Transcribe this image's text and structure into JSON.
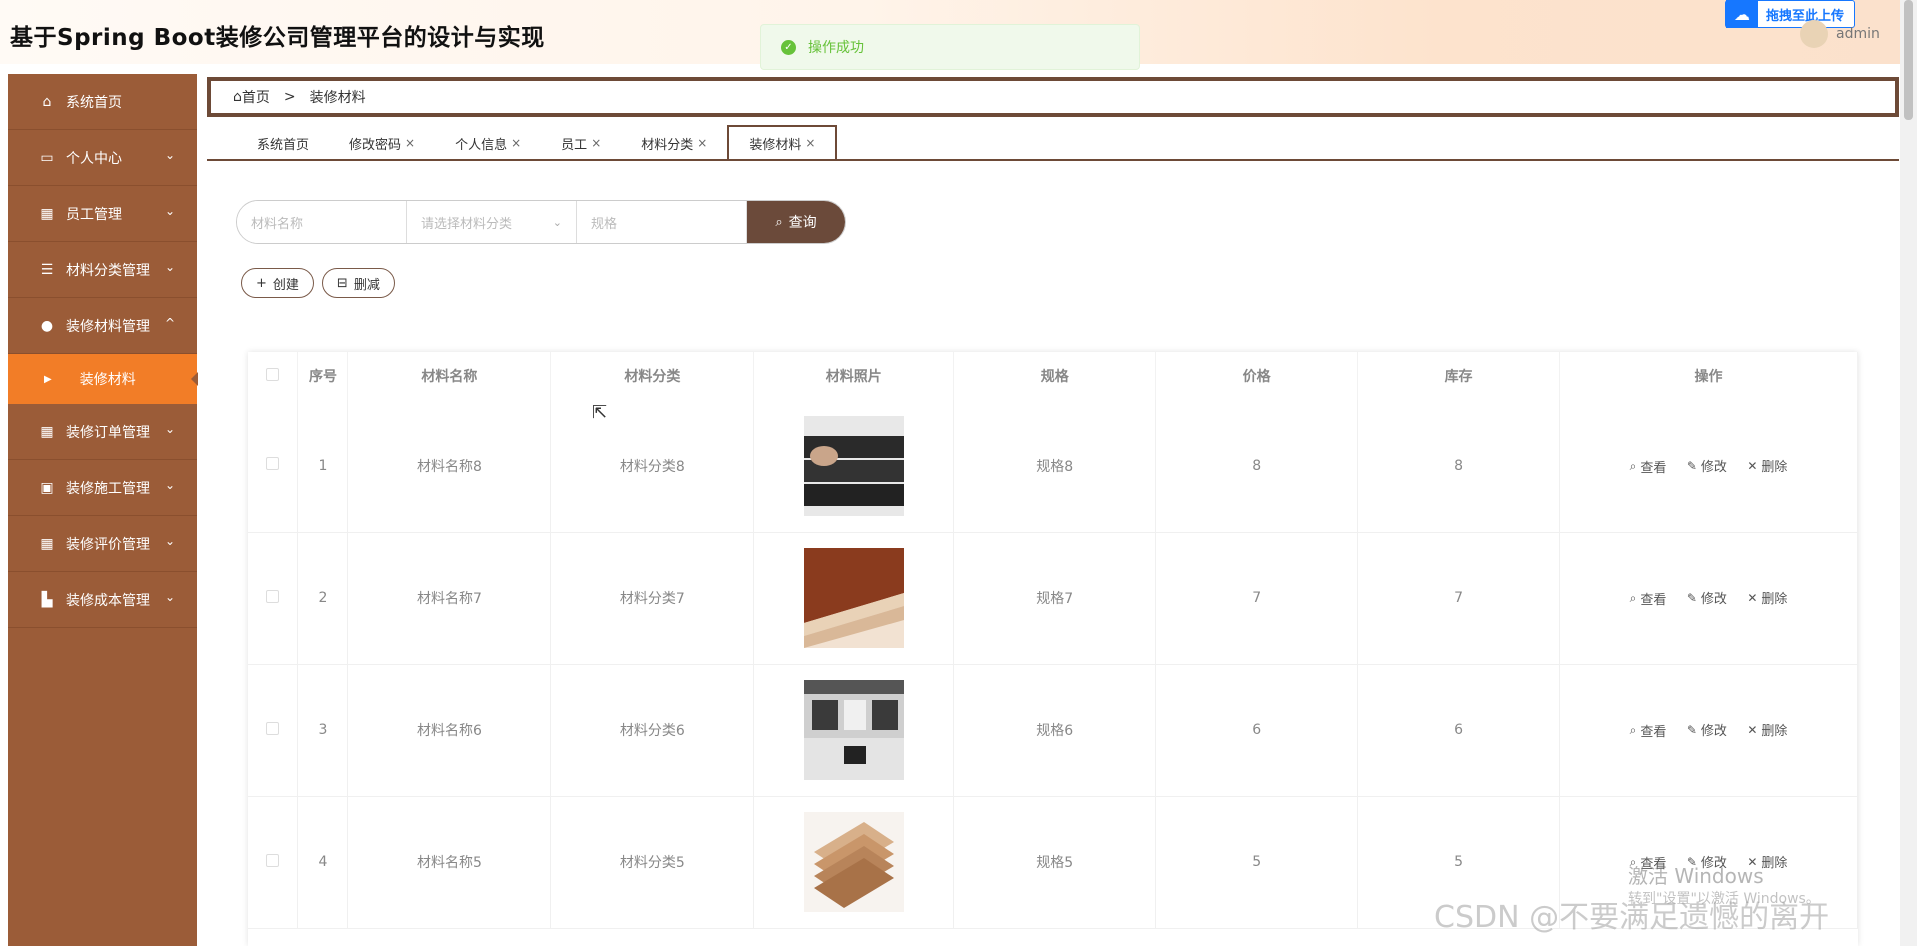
{
  "app": {
    "title": "基于Spring Boot装修公司管理平台的设计与实现",
    "toast": "操作成功",
    "upload_badge": "拖拽至此上传",
    "user": "admin"
  },
  "sidebar": {
    "items": [
      {
        "label": "系统首页",
        "icon": "home-icon",
        "chevron": ""
      },
      {
        "label": "个人中心",
        "icon": "card-icon",
        "chevron": "⌄"
      },
      {
        "label": "员工管理",
        "icon": "grid-icon",
        "chevron": "⌄"
      },
      {
        "label": "材料分类管理",
        "icon": "list-icon",
        "chevron": "⌄"
      },
      {
        "label": "装修材料管理",
        "icon": "bulb-icon",
        "chevron": "^"
      },
      {
        "label": "装修订单管理",
        "icon": "grid-icon",
        "chevron": "⌄"
      },
      {
        "label": "装修施工管理",
        "icon": "clipboard-icon",
        "chevron": "⌄"
      },
      {
        "label": "装修评价管理",
        "icon": "grid-icon",
        "chevron": "⌄"
      },
      {
        "label": "装修成本管理",
        "icon": "shop-icon",
        "chevron": "⌄"
      }
    ],
    "active_sub": "装修材料"
  },
  "breadcrumb": {
    "home": "首页",
    "sep": ">",
    "current": "装修材料"
  },
  "tabs": [
    {
      "label": "系统首页",
      "close": ""
    },
    {
      "label": "修改密码",
      "close": "×"
    },
    {
      "label": "个人信息",
      "close": "×"
    },
    {
      "label": "员工",
      "close": "×"
    },
    {
      "label": "材料分类",
      "close": "×"
    },
    {
      "label": "装修材料",
      "close": "×"
    }
  ],
  "search": {
    "name_placeholder": "材料名称",
    "category_placeholder": "请选择材料分类",
    "spec_placeholder": "规格",
    "button": "查询"
  },
  "actions": {
    "create": "创建",
    "delete": "删减"
  },
  "table": {
    "headers": [
      "序号",
      "材料名称",
      "材料分类",
      "材料照片",
      "规格",
      "价格",
      "库存",
      "操作"
    ],
    "ops": {
      "view": "查看",
      "edit": "修改",
      "delete": "删除"
    },
    "rows": [
      {
        "no": "1",
        "name": "材料名称8",
        "category": "材料分类8",
        "spec": "规格8",
        "price": "8",
        "stock": "8"
      },
      {
        "no": "2",
        "name": "材料名称7",
        "category": "材料分类7",
        "spec": "规格7",
        "price": "7",
        "stock": "7"
      },
      {
        "no": "3",
        "name": "材料名称6",
        "category": "材料分类6",
        "spec": "规格6",
        "price": "6",
        "stock": "6"
      },
      {
        "no": "4",
        "name": "材料名称5",
        "category": "材料分类5",
        "spec": "规格5",
        "price": "5",
        "stock": "5"
      }
    ]
  },
  "overlay": {
    "activate_title": "激活 Windows",
    "activate_sub": "转到\"设置\"以激活 Windows。",
    "csdn": "CSDN @不要满足遗憾的离开"
  }
}
